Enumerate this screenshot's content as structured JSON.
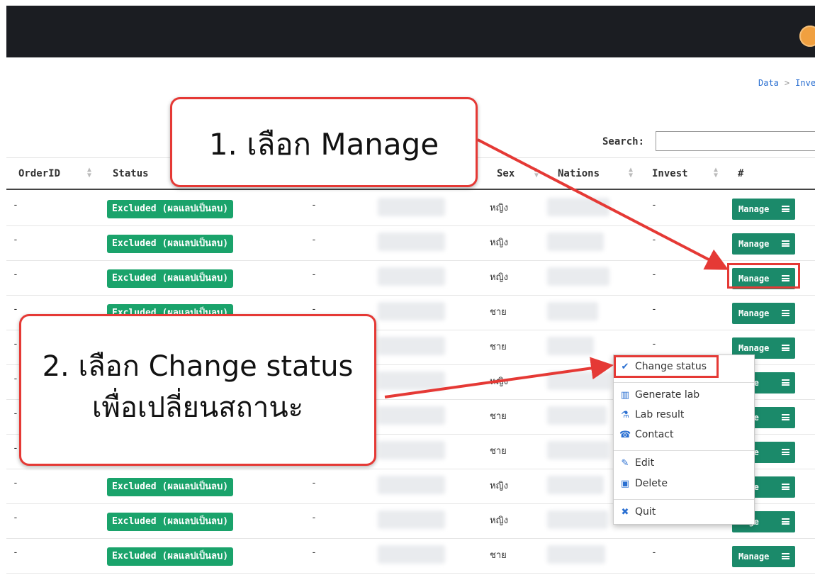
{
  "header": {
    "colors": {
      "bar": "#1b1d22",
      "avatar": "#f0a040"
    }
  },
  "breadcrumb": {
    "item1": "Data",
    "separator": ">",
    "item2": "Inve"
  },
  "search": {
    "label": "Search:",
    "value": ""
  },
  "table": {
    "columns": [
      "OrderID",
      "Status",
      "Sex",
      "Nations",
      "Invest",
      "#"
    ],
    "rows": [
      {
        "order_id": "-",
        "status": "Excluded (ผลแลปเป็นลบ)",
        "col3": "-",
        "sex": "หญิง",
        "invest": "-",
        "action": "Manage"
      },
      {
        "order_id": "-",
        "status": "Excluded (ผลแลปเป็นลบ)",
        "col3": "-",
        "sex": "หญิง",
        "invest": "-",
        "action": "Manage"
      },
      {
        "order_id": "-",
        "status": "Excluded (ผลแลปเป็นลบ)",
        "col3": "-",
        "sex": "หญิง",
        "invest": "-",
        "action": "Manage"
      },
      {
        "order_id": "-",
        "status": "Excluded (ผลแลปเป็นลบ)",
        "col3": "-",
        "sex": "ชาย",
        "invest": "-",
        "action": "Manage"
      },
      {
        "order_id": "-",
        "status": "",
        "col3": "",
        "sex": "ชาย",
        "invest": "-",
        "action": "Manage"
      },
      {
        "order_id": "-",
        "status": "",
        "col3": "",
        "sex": "หญิง",
        "invest": "",
        "action": "nage"
      },
      {
        "order_id": "-",
        "status": "",
        "col3": "",
        "sex": "ชาย",
        "invest": "",
        "action": "nage"
      },
      {
        "order_id": "-",
        "status": "",
        "col3": "",
        "sex": "ชาย",
        "invest": "",
        "action": "nage"
      },
      {
        "order_id": "-",
        "status": "Excluded (ผลแลปเป็นลบ)",
        "col3": "-",
        "sex": "หญิง",
        "invest": "",
        "action": "nage"
      },
      {
        "order_id": "-",
        "status": "Excluded (ผลแลปเป็นลบ)",
        "col3": "-",
        "sex": "หญิง",
        "invest": "",
        "action": "nage"
      },
      {
        "order_id": "-",
        "status": "Excluded (ผลแลปเป็นลบ)",
        "col3": "-",
        "sex": "ชาย",
        "invest": "-",
        "action": "Manage"
      }
    ]
  },
  "dropdown": {
    "items": [
      {
        "label": "Change status",
        "icon": "check-circle-icon"
      },
      {
        "label": "Generate lab",
        "icon": "barcode-icon"
      },
      {
        "label": "Lab result",
        "icon": "flask-icon"
      },
      {
        "label": "Contact",
        "icon": "handshake-icon"
      },
      {
        "label": "Edit",
        "icon": "edit-icon"
      },
      {
        "label": "Delete",
        "icon": "trash-icon"
      },
      {
        "label": "Quit",
        "icon": "close-icon"
      }
    ]
  },
  "callouts": {
    "step1": "1. เลือก Manage",
    "step2_line1": "2. เลือก Change status",
    "step2_line2": "เพื่อเปลี่ยนสถานะ"
  },
  "colors": {
    "status_badge": "#1aa36b",
    "manage_button": "#1b8a6a",
    "annotation_red": "#e53935"
  }
}
